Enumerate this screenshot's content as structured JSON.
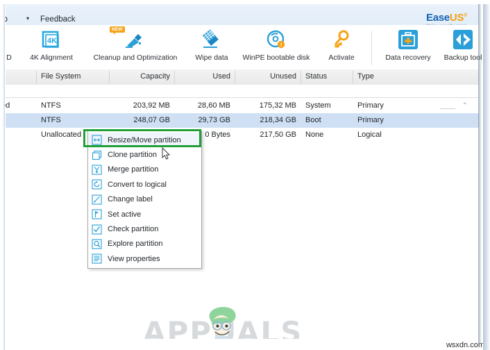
{
  "window": {
    "menubar": {
      "help_label": "lp",
      "caret": "▾",
      "feedback_label": "Feedback"
    },
    "brand": {
      "name_part1": "Ease",
      "name_part2": "US",
      "registered": "®",
      "tagline": "Make your life easy!",
      "color_blue": "#1763b5",
      "color_orange": "#f5a012"
    }
  },
  "toolbar": {
    "items": [
      {
        "label": "D",
        "icon": "partial-cut-icon",
        "badge": ""
      },
      {
        "label": "4K Alignment",
        "icon": "4k-alignment-icon",
        "badge": ""
      },
      {
        "label": "Cleanup and Optimization",
        "icon": "cleanup-broom-icon",
        "badge": "NEW"
      },
      {
        "label": "Wipe data",
        "icon": "wipe-data-icon",
        "badge": ""
      },
      {
        "label": "WinPE bootable disk",
        "icon": "winpe-disc-icon",
        "badge": ""
      },
      {
        "label": "Activate",
        "icon": "key-icon",
        "badge": ""
      }
    ],
    "right_items": [
      {
        "label": "Data recovery",
        "icon": "first-aid-kit-icon"
      },
      {
        "label": "Backup tool",
        "icon": "backup-diamond-icon"
      }
    ]
  },
  "table": {
    "headers": [
      "File System",
      "Capacity",
      "Used",
      "Unused",
      "Status",
      "Type"
    ],
    "rows": [
      {
        "partial_name": "ed",
        "file_system": "NTFS",
        "capacity": "203,92 MB",
        "used": "28,60 MB",
        "unused": "175,32 MB",
        "status": "System",
        "type": "Primary",
        "selected": false
      },
      {
        "partial_name": "",
        "file_system": "NTFS",
        "capacity": "248,07 GB",
        "used": "29,73 GB",
        "unused": "218,34 GB",
        "status": "Boot",
        "type": "Primary",
        "selected": true
      },
      {
        "partial_name": "",
        "file_system": "Unallocated",
        "capacity": "217,50 GB",
        "used": "0 Bytes",
        "unused": "217,50 GB",
        "status": "None",
        "type": "Logical",
        "selected": false
      }
    ],
    "collapse_icon": "⌃",
    "selected_row_color": "#cfe0f5"
  },
  "context_menu": {
    "highlight_color": "#21a038",
    "items": [
      {
        "label": "Resize/Move partition",
        "icon": "resize-arrows-icon",
        "highlighted": true
      },
      {
        "label": "Clone partition",
        "icon": "clone-squares-icon",
        "highlighted": false
      },
      {
        "label": "Merge partition",
        "icon": "merge-arrow-icon",
        "highlighted": false
      },
      {
        "label": "Convert to logical",
        "icon": "convert-refresh-icon",
        "highlighted": false
      },
      {
        "label": "Change label",
        "icon": "pencil-icon",
        "highlighted": false
      },
      {
        "label": "Set active",
        "icon": "flag-icon",
        "highlighted": false
      },
      {
        "label": "Check partition",
        "icon": "checkmark-icon",
        "highlighted": false
      },
      {
        "label": "Explore partition",
        "icon": "magnifier-icon",
        "highlighted": false
      },
      {
        "label": "View properties",
        "icon": "document-lines-icon",
        "highlighted": false
      }
    ]
  },
  "watermark": {
    "text": "APPUALS",
    "site": "wsxdn.com"
  }
}
